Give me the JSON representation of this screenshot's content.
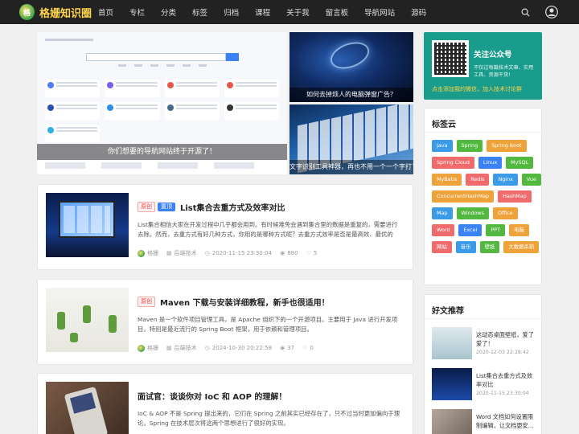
{
  "site": {
    "name": "格姗知识圈",
    "logo_text": "格"
  },
  "nav": [
    "首页",
    "专栏",
    "分类",
    "标签",
    "归档",
    "课程",
    "关于我",
    "留言板",
    "导航网站",
    "源码"
  ],
  "hero": {
    "main_caption": "你们想要的导航网站终于开源了！",
    "side1_caption": "如何去掉烦人的电脑弹窗广告？",
    "side2_caption": "文字识别工具神器，再也不用一个一个字打了！"
  },
  "posts": [
    {
      "badges": [
        "原创",
        "置顶"
      ],
      "title": "List集合去重方式及效率对比",
      "excerpt": "List集合相信大家在开发过程中几乎都会用到。有时候难免会遇到集合里的数据是重复的，需要进行去除。然而，去重方式有好几种方式，你用的是哪种方式呢？去重方式效率是否是最高效、最优的呢？今天就给...",
      "author": "格姗",
      "category": "后端技术",
      "date": "2020-11-15 23:30:04",
      "views": "880",
      "likes": "5"
    },
    {
      "badges": [
        "原创"
      ],
      "title": "Maven 下载与安装详细教程，新手也很适用！",
      "excerpt": "Maven 是一个软件项目管理工具，是 Apache 组织下的一个开源项目。主要用于 Java 进行开发项目，特别是最近流行的 Spring Boot 框架，用于依赖和管理项目。",
      "author": "格姗",
      "category": "后端技术",
      "date": "2024-10-30 20:22:58",
      "views": "37",
      "likes": "0"
    },
    {
      "badges": [],
      "title": "面试官：谈谈你对 IoC 和 AOP 的理解！",
      "excerpt": "IoC & AOP 不是 Spring 提出来的，它们在 Spring 之前其实已经存在了，只不过当时更加偏向于理论。Spring 在技术层次将这两个思想进行了很好的实现。",
      "author": "",
      "category": "",
      "date": "",
      "views": "",
      "likes": ""
    }
  ],
  "wechat": {
    "title": "关注公众号",
    "desc": "不仅过每篇技术文章、实用工具、资源干货!",
    "link": "点击添加我的微信，加入技术讨论群"
  },
  "tagcloud": {
    "title": "标签云",
    "tags": [
      {
        "label": "Java",
        "color": "#3b9be8"
      },
      {
        "label": "Spring",
        "color": "#52b83f"
      },
      {
        "label": "Spring Boot",
        "color": "#f0a23a"
      },
      {
        "label": "Spring Cloud",
        "color": "#f06c6c"
      },
      {
        "label": "Linux",
        "color": "#3b82f6"
      },
      {
        "label": "MySQL",
        "color": "#52b83f"
      },
      {
        "label": "MyBatis",
        "color": "#f0a23a"
      },
      {
        "label": "Redis",
        "color": "#f06c6c"
      },
      {
        "label": "Nginx",
        "color": "#3b9be8"
      },
      {
        "label": "Vue",
        "color": "#52b83f"
      },
      {
        "label": "ConcurrentHashMap",
        "color": "#f0a23a"
      },
      {
        "label": "HashMap",
        "color": "#f06c6c"
      },
      {
        "label": "Map",
        "color": "#3b9be8"
      },
      {
        "label": "Windows",
        "color": "#52b83f"
      },
      {
        "label": "Office",
        "color": "#f0a23a"
      },
      {
        "label": "Word",
        "color": "#f06c6c"
      },
      {
        "label": "Excel",
        "color": "#3b82f6"
      },
      {
        "label": "PPT",
        "color": "#52b83f"
      },
      {
        "label": "电脑",
        "color": "#f0a23a"
      },
      {
        "label": "网站",
        "color": "#f06c6c"
      },
      {
        "label": "音乐",
        "color": "#3b9be8"
      },
      {
        "label": "壁纸",
        "color": "#52b83f"
      },
      {
        "label": "大数据杀熟",
        "color": "#f0a23a"
      }
    ]
  },
  "friends": {
    "title": "好文推荐",
    "items": [
      {
        "title": "这动态桌面壁纸，爱了爱了！",
        "date": "2020-12-03 22:28:42"
      },
      {
        "title": "List集合去重方式及效率对比",
        "date": "2020-11-15 23:30:04"
      },
      {
        "title": "Word 文档如何设置限制编辑，让文档更安...",
        "date": ""
      }
    ]
  },
  "colors": {
    "header_bg": "#222222",
    "brand": "#ffd64a",
    "wechat_bg": "#199c8c",
    "badge_top": "#3b82f6",
    "badge_orig": "#ee4444"
  }
}
